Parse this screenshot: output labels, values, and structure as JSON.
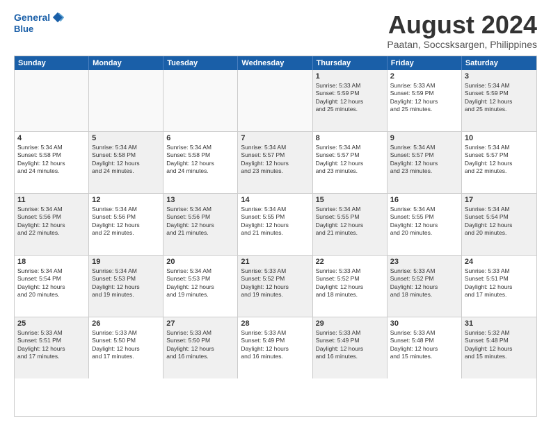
{
  "logo": {
    "line1": "General",
    "line2": "Blue"
  },
  "title": "August 2024",
  "location": "Paatan, Soccsksargen, Philippines",
  "days_of_week": [
    "Sunday",
    "Monday",
    "Tuesday",
    "Wednesday",
    "Thursday",
    "Friday",
    "Saturday"
  ],
  "weeks": [
    [
      {
        "day": "",
        "empty": true,
        "lines": []
      },
      {
        "day": "",
        "empty": true,
        "lines": []
      },
      {
        "day": "",
        "empty": true,
        "lines": []
      },
      {
        "day": "",
        "empty": true,
        "lines": []
      },
      {
        "day": "1",
        "shaded": true,
        "lines": [
          "Sunrise: 5:33 AM",
          "Sunset: 5:59 PM",
          "Daylight: 12 hours",
          "and 25 minutes."
        ]
      },
      {
        "day": "2",
        "lines": [
          "Sunrise: 5:33 AM",
          "Sunset: 5:59 PM",
          "Daylight: 12 hours",
          "and 25 minutes."
        ]
      },
      {
        "day": "3",
        "shaded": true,
        "lines": [
          "Sunrise: 5:34 AM",
          "Sunset: 5:59 PM",
          "Daylight: 12 hours",
          "and 25 minutes."
        ]
      }
    ],
    [
      {
        "day": "4",
        "lines": [
          "Sunrise: 5:34 AM",
          "Sunset: 5:58 PM",
          "Daylight: 12 hours",
          "and 24 minutes."
        ]
      },
      {
        "day": "5",
        "shaded": true,
        "lines": [
          "Sunrise: 5:34 AM",
          "Sunset: 5:58 PM",
          "Daylight: 12 hours",
          "and 24 minutes."
        ]
      },
      {
        "day": "6",
        "lines": [
          "Sunrise: 5:34 AM",
          "Sunset: 5:58 PM",
          "Daylight: 12 hours",
          "and 24 minutes."
        ]
      },
      {
        "day": "7",
        "shaded": true,
        "lines": [
          "Sunrise: 5:34 AM",
          "Sunset: 5:57 PM",
          "Daylight: 12 hours",
          "and 23 minutes."
        ]
      },
      {
        "day": "8",
        "lines": [
          "Sunrise: 5:34 AM",
          "Sunset: 5:57 PM",
          "Daylight: 12 hours",
          "and 23 minutes."
        ]
      },
      {
        "day": "9",
        "shaded": true,
        "lines": [
          "Sunrise: 5:34 AM",
          "Sunset: 5:57 PM",
          "Daylight: 12 hours",
          "and 23 minutes."
        ]
      },
      {
        "day": "10",
        "lines": [
          "Sunrise: 5:34 AM",
          "Sunset: 5:57 PM",
          "Daylight: 12 hours",
          "and 22 minutes."
        ]
      }
    ],
    [
      {
        "day": "11",
        "shaded": true,
        "lines": [
          "Sunrise: 5:34 AM",
          "Sunset: 5:56 PM",
          "Daylight: 12 hours",
          "and 22 minutes."
        ]
      },
      {
        "day": "12",
        "lines": [
          "Sunrise: 5:34 AM",
          "Sunset: 5:56 PM",
          "Daylight: 12 hours",
          "and 22 minutes."
        ]
      },
      {
        "day": "13",
        "shaded": true,
        "lines": [
          "Sunrise: 5:34 AM",
          "Sunset: 5:56 PM",
          "Daylight: 12 hours",
          "and 21 minutes."
        ]
      },
      {
        "day": "14",
        "lines": [
          "Sunrise: 5:34 AM",
          "Sunset: 5:55 PM",
          "Daylight: 12 hours",
          "and 21 minutes."
        ]
      },
      {
        "day": "15",
        "shaded": true,
        "lines": [
          "Sunrise: 5:34 AM",
          "Sunset: 5:55 PM",
          "Daylight: 12 hours",
          "and 21 minutes."
        ]
      },
      {
        "day": "16",
        "lines": [
          "Sunrise: 5:34 AM",
          "Sunset: 5:55 PM",
          "Daylight: 12 hours",
          "and 20 minutes."
        ]
      },
      {
        "day": "17",
        "shaded": true,
        "lines": [
          "Sunrise: 5:34 AM",
          "Sunset: 5:54 PM",
          "Daylight: 12 hours",
          "and 20 minutes."
        ]
      }
    ],
    [
      {
        "day": "18",
        "lines": [
          "Sunrise: 5:34 AM",
          "Sunset: 5:54 PM",
          "Daylight: 12 hours",
          "and 20 minutes."
        ]
      },
      {
        "day": "19",
        "shaded": true,
        "lines": [
          "Sunrise: 5:34 AM",
          "Sunset: 5:53 PM",
          "Daylight: 12 hours",
          "and 19 minutes."
        ]
      },
      {
        "day": "20",
        "lines": [
          "Sunrise: 5:34 AM",
          "Sunset: 5:53 PM",
          "Daylight: 12 hours",
          "and 19 minutes."
        ]
      },
      {
        "day": "21",
        "shaded": true,
        "lines": [
          "Sunrise: 5:33 AM",
          "Sunset: 5:52 PM",
          "Daylight: 12 hours",
          "and 19 minutes."
        ]
      },
      {
        "day": "22",
        "lines": [
          "Sunrise: 5:33 AM",
          "Sunset: 5:52 PM",
          "Daylight: 12 hours",
          "and 18 minutes."
        ]
      },
      {
        "day": "23",
        "shaded": true,
        "lines": [
          "Sunrise: 5:33 AM",
          "Sunset: 5:52 PM",
          "Daylight: 12 hours",
          "and 18 minutes."
        ]
      },
      {
        "day": "24",
        "lines": [
          "Sunrise: 5:33 AM",
          "Sunset: 5:51 PM",
          "Daylight: 12 hours",
          "and 17 minutes."
        ]
      }
    ],
    [
      {
        "day": "25",
        "shaded": true,
        "lines": [
          "Sunrise: 5:33 AM",
          "Sunset: 5:51 PM",
          "Daylight: 12 hours",
          "and 17 minutes."
        ]
      },
      {
        "day": "26",
        "lines": [
          "Sunrise: 5:33 AM",
          "Sunset: 5:50 PM",
          "Daylight: 12 hours",
          "and 17 minutes."
        ]
      },
      {
        "day": "27",
        "shaded": true,
        "lines": [
          "Sunrise: 5:33 AM",
          "Sunset: 5:50 PM",
          "Daylight: 12 hours",
          "and 16 minutes."
        ]
      },
      {
        "day": "28",
        "lines": [
          "Sunrise: 5:33 AM",
          "Sunset: 5:49 PM",
          "Daylight: 12 hours",
          "and 16 minutes."
        ]
      },
      {
        "day": "29",
        "shaded": true,
        "lines": [
          "Sunrise: 5:33 AM",
          "Sunset: 5:49 PM",
          "Daylight: 12 hours",
          "and 16 minutes."
        ]
      },
      {
        "day": "30",
        "lines": [
          "Sunrise: 5:33 AM",
          "Sunset: 5:48 PM",
          "Daylight: 12 hours",
          "and 15 minutes."
        ]
      },
      {
        "day": "31",
        "shaded": true,
        "lines": [
          "Sunrise: 5:32 AM",
          "Sunset: 5:48 PM",
          "Daylight: 12 hours",
          "and 15 minutes."
        ]
      }
    ]
  ]
}
